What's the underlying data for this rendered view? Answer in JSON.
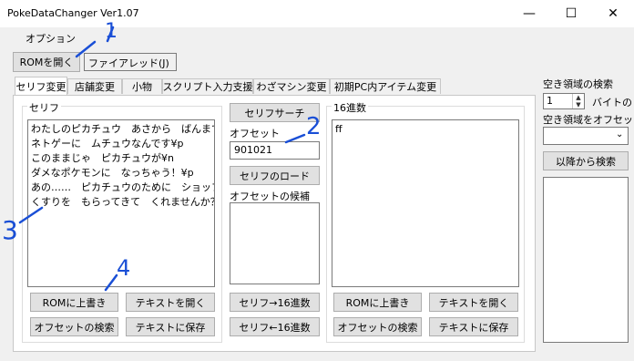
{
  "window": {
    "title": "PokeDataChanger Ver1.07",
    "minimize": "—",
    "maximize": "☐",
    "close": "✕"
  },
  "menu": {
    "options": "オプション"
  },
  "rom": {
    "open_label": "ROMを開く",
    "rom_name": "ファイアレッド(J)"
  },
  "tabs": [
    {
      "label": "セリフ変更"
    },
    {
      "label": "店舗変更"
    },
    {
      "label": "小物"
    },
    {
      "label": "スクリプト入力支援"
    },
    {
      "label": "わざマシン変更"
    },
    {
      "label": "初期PC内アイテム変更"
    }
  ],
  "serif": {
    "group_label": "セリフ",
    "text": "わたしのピカチュウ　あさから　ばんまで¥n\nネトゲーに　ムチュウなんです¥p\nこのままじゃ　ピカチュウが¥n\nダメなポケモンに　なっちゃう！¥p\nあの……　ピカチュウのために　ショップで¥n\nくすりを　もらってきて　くれませんか？",
    "btn_rom_write": "ROMに上書き",
    "btn_text_open": "テキストを開く",
    "btn_offset_search": "オフセットの検索",
    "btn_text_save": "テキストに保存"
  },
  "middle": {
    "serif_search": "セリフサーチ",
    "offset_label": "オフセット",
    "offset_value": "901021",
    "serif_load": "セリフのロード",
    "candidates_label": "オフセットの候補",
    "to_hex": "セリフ→16進数",
    "from_hex": "セリフ←16進数"
  },
  "hex": {
    "group_label": "16進数",
    "text": "ff",
    "btn_rom_write": "ROMに上書き",
    "btn_text_open": "テキストを開く",
    "btn_offset_search": "オフセットの検索",
    "btn_text_save": "テキストに保存"
  },
  "free_space": {
    "heading": "空き領域の検索",
    "bytes_value": "1",
    "bytes_label": "バイトの",
    "offset_label": "空き領域をオフセット",
    "search_after": "以降から検索"
  },
  "annotations": [
    "1",
    "2",
    "3",
    "4"
  ]
}
